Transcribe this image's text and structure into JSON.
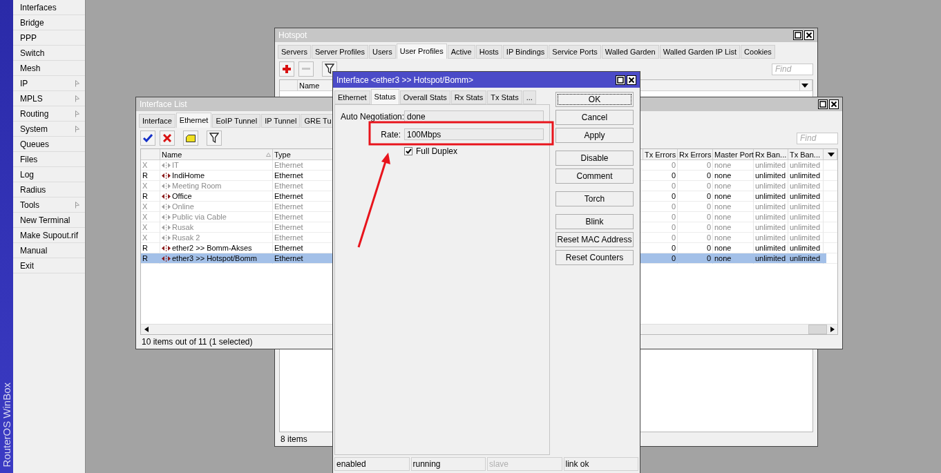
{
  "sidebar": {
    "brand": "RouterOS WinBox",
    "items": [
      {
        "label": "Interfaces",
        "has_submenu": false
      },
      {
        "label": "Bridge",
        "has_submenu": false
      },
      {
        "label": "PPP",
        "has_submenu": false
      },
      {
        "label": "Switch",
        "has_submenu": false
      },
      {
        "label": "Mesh",
        "has_submenu": false
      },
      {
        "label": "IP",
        "has_submenu": true
      },
      {
        "label": "MPLS",
        "has_submenu": true
      },
      {
        "label": "Routing",
        "has_submenu": true
      },
      {
        "label": "System",
        "has_submenu": true
      },
      {
        "label": "Queues",
        "has_submenu": false
      },
      {
        "label": "Files",
        "has_submenu": false
      },
      {
        "label": "Log",
        "has_submenu": false
      },
      {
        "label": "Radius",
        "has_submenu": false
      },
      {
        "label": "Tools",
        "has_submenu": true
      },
      {
        "label": "New Terminal",
        "has_submenu": false
      },
      {
        "label": "Make Supout.rif",
        "has_submenu": false
      },
      {
        "label": "Manual",
        "has_submenu": false
      },
      {
        "label": "Exit",
        "has_submenu": false
      }
    ]
  },
  "hotspot": {
    "title": "Hotspot",
    "tabs": [
      {
        "label": "Servers",
        "selected": false
      },
      {
        "label": "Server Profiles",
        "selected": false
      },
      {
        "label": "Users",
        "selected": false
      },
      {
        "label": "User Profiles",
        "selected": true
      },
      {
        "label": "Active",
        "selected": false
      },
      {
        "label": "Hosts",
        "selected": false
      },
      {
        "label": "IP Bindings",
        "selected": false
      },
      {
        "label": "Service Ports",
        "selected": false
      },
      {
        "label": "Walled Garden",
        "selected": false
      },
      {
        "label": "Walled Garden IP List",
        "selected": false
      },
      {
        "label": "Cookies",
        "selected": false
      }
    ],
    "find_placeholder": "Find",
    "columns": [
      "Name"
    ],
    "status": "8 items"
  },
  "interface_list": {
    "title": "Interface List",
    "tabs": [
      {
        "label": "Interface",
        "selected": false
      },
      {
        "label": "Ethernet",
        "selected": true
      },
      {
        "label": "EoIP Tunnel",
        "selected": false
      },
      {
        "label": "IP Tunnel",
        "selected": false
      },
      {
        "label": "GRE Tu",
        "selected": false
      }
    ],
    "find_placeholder": "Find",
    "columns_left": [
      "Name",
      "Type"
    ],
    "columns_right": [
      "Tx Errors",
      "Rx Errors",
      "Master Port",
      "Rx Ban...",
      "Tx Ban..."
    ],
    "rows": [
      {
        "flag": "X",
        "name": "IT",
        "type": "Ethernet",
        "tx_errors": "0",
        "rx_errors": "0",
        "master_port": "none",
        "rx_bandwidth": "unlimited",
        "tx_bandwidth": "unlimited",
        "disabled": true,
        "selected": false
      },
      {
        "flag": "R",
        "name": "IndiHome",
        "type": "Ethernet",
        "tx_errors": "0",
        "rx_errors": "0",
        "master_port": "none",
        "rx_bandwidth": "unlimited",
        "tx_bandwidth": "unlimited",
        "disabled": false,
        "selected": false
      },
      {
        "flag": "X",
        "name": "Meeting Room",
        "type": "Ethernet",
        "tx_errors": "0",
        "rx_errors": "0",
        "master_port": "none",
        "rx_bandwidth": "unlimited",
        "tx_bandwidth": "unlimited",
        "disabled": true,
        "selected": false
      },
      {
        "flag": "R",
        "name": "Office",
        "type": "Ethernet",
        "tx_errors": "0",
        "rx_errors": "0",
        "master_port": "none",
        "rx_bandwidth": "unlimited",
        "tx_bandwidth": "unlimited",
        "disabled": false,
        "selected": false
      },
      {
        "flag": "X",
        "name": "Online",
        "type": "Ethernet",
        "tx_errors": "0",
        "rx_errors": "0",
        "master_port": "none",
        "rx_bandwidth": "unlimited",
        "tx_bandwidth": "unlimited",
        "disabled": true,
        "selected": false
      },
      {
        "flag": "X",
        "name": "Public via Cable",
        "type": "Ethernet",
        "tx_errors": "0",
        "rx_errors": "0",
        "master_port": "none",
        "rx_bandwidth": "unlimited",
        "tx_bandwidth": "unlimited",
        "disabled": true,
        "selected": false
      },
      {
        "flag": "X",
        "name": "Rusak",
        "type": "Ethernet",
        "tx_errors": "0",
        "rx_errors": "0",
        "master_port": "none",
        "rx_bandwidth": "unlimited",
        "tx_bandwidth": "unlimited",
        "disabled": true,
        "selected": false
      },
      {
        "flag": "X",
        "name": "Rusak 2",
        "type": "Ethernet",
        "tx_errors": "0",
        "rx_errors": "0",
        "master_port": "none",
        "rx_bandwidth": "unlimited",
        "tx_bandwidth": "unlimited",
        "disabled": true,
        "selected": false
      },
      {
        "flag": "R",
        "name": "ether2 >> Bomm-Akses",
        "type": "Ethernet",
        "tx_errors": "0",
        "rx_errors": "0",
        "master_port": "none",
        "rx_bandwidth": "unlimited",
        "tx_bandwidth": "unlimited",
        "disabled": false,
        "selected": false
      },
      {
        "flag": "R",
        "name": "ether3 >> Hotspot/Bomm",
        "type": "Ethernet",
        "tx_errors": "0",
        "rx_errors": "0",
        "master_port": "none",
        "rx_bandwidth": "unlimited",
        "tx_bandwidth": "unlimited",
        "disabled": false,
        "selected": true
      }
    ],
    "status": "10 items out of 11 (1 selected)"
  },
  "interface_dialog": {
    "title": "Interface <ether3 >> Hotspot/Bomm>",
    "tabs": [
      {
        "label": "Ethernet",
        "selected": false
      },
      {
        "label": "Status",
        "selected": true
      },
      {
        "label": "Overall Stats",
        "selected": false
      },
      {
        "label": "Rx Stats",
        "selected": false
      },
      {
        "label": "Tx Stats",
        "selected": false
      },
      {
        "label": "...",
        "selected": false
      }
    ],
    "fields": [
      {
        "label": "Auto Negotiation:",
        "value": "done"
      },
      {
        "label": "Rate:",
        "value": "100Mbps"
      }
    ],
    "full_duplex": {
      "label": "Full Duplex",
      "checked": true
    },
    "button_groups": [
      [
        {
          "label": "OK",
          "focused": true
        },
        {
          "label": "Cancel",
          "focused": false
        },
        {
          "label": "Apply",
          "focused": false
        }
      ],
      [
        {
          "label": "Disable",
          "focused": false
        },
        {
          "label": "Comment",
          "focused": false
        }
      ],
      [
        {
          "label": "Torch",
          "focused": false
        }
      ],
      [
        {
          "label": "Blink",
          "focused": false
        },
        {
          "label": "Reset MAC Address",
          "focused": false
        },
        {
          "label": "Reset Counters",
          "focused": false
        }
      ]
    ],
    "status_bar": [
      {
        "text": "enabled",
        "disabled": false
      },
      {
        "text": "running",
        "disabled": false
      },
      {
        "text": "slave",
        "disabled": true
      },
      {
        "text": "link ok",
        "disabled": false
      }
    ]
  }
}
